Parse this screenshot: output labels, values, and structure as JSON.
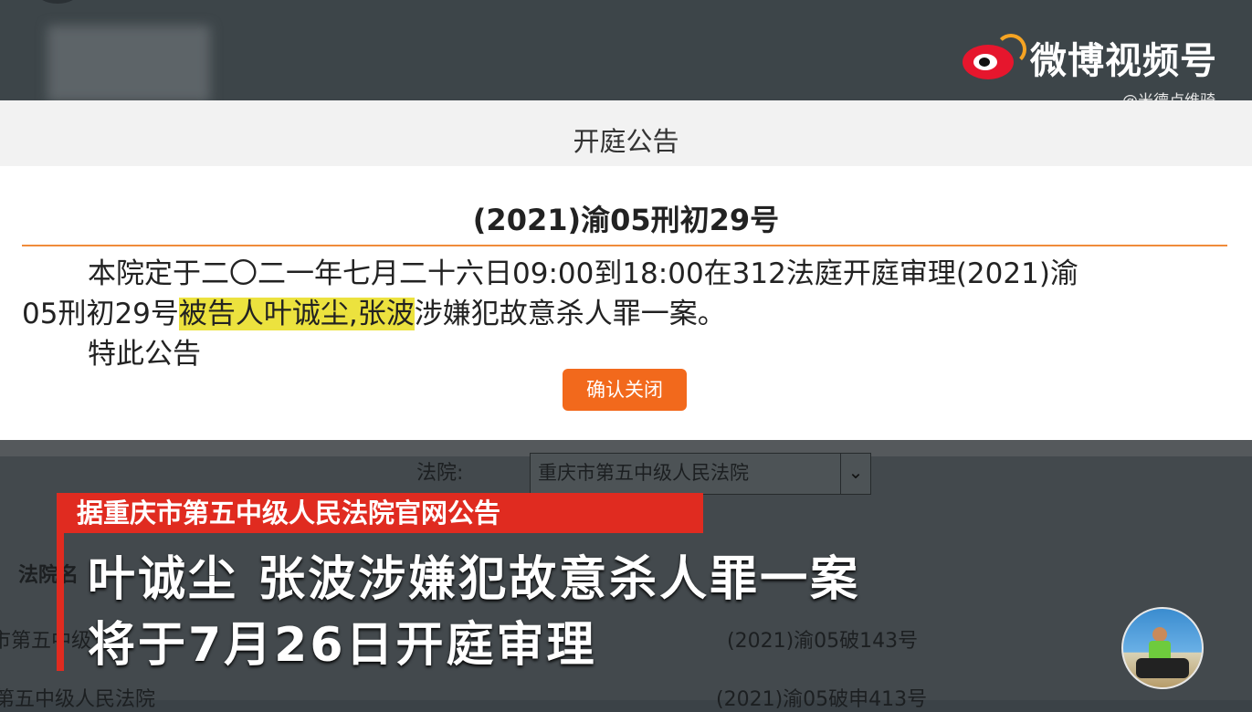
{
  "watermark": {
    "brand": "微博视频号",
    "user": "@米德卢维骑"
  },
  "modal": {
    "header_title": "开庭公告",
    "case_number": "(2021)渝05刑初29号",
    "paragraph": {
      "line1": "本院定于二〇二一年七月二十六日09:00到18:00在312法庭开庭审理(2021)渝",
      "line2_prefix": "05刑初29号",
      "line2_highlight": "被告人叶诚尘,张波",
      "line2_suffix": "涉嫌犯故意杀人罪一案。",
      "line3": "特此公告"
    },
    "confirm_button": "确认关闭"
  },
  "underlying_page": {
    "court_label": "法院:",
    "court_select_value": "重庆市第五中级人民法院",
    "column_header": "法院名",
    "rows": [
      {
        "left": "市第五中级",
        "right": "(2021)渝05破143号"
      },
      {
        "left": "第五中级人民法院",
        "right": "(2021)渝05破申413号"
      }
    ]
  },
  "captions": {
    "source": "据重庆市第五中级人民法院官网公告",
    "line1": "叶诚尘 张波涉嫌犯故意杀人罪一案",
    "line2": "将于7月26日开庭审理"
  },
  "colors": {
    "accent_orange": "#f2691c",
    "highlight_yellow": "#ece23e",
    "caption_red": "#e02b20",
    "weibo_red": "#e6162d"
  }
}
